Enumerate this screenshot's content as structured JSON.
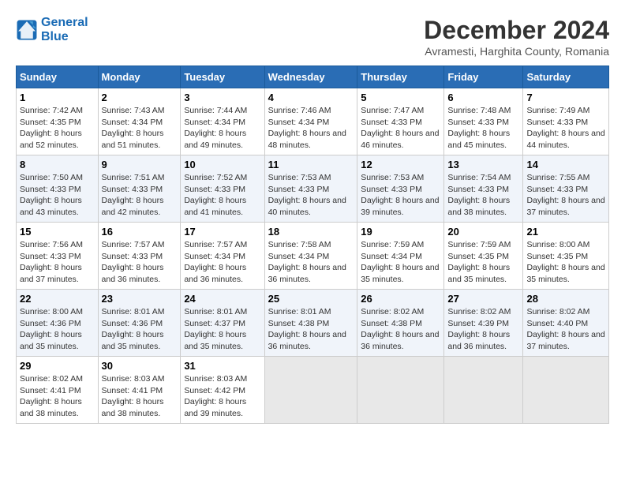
{
  "header": {
    "logo_line1": "General",
    "logo_line2": "Blue",
    "month_title": "December 2024",
    "location": "Avramesti, Harghita County, Romania"
  },
  "weekdays": [
    "Sunday",
    "Monday",
    "Tuesday",
    "Wednesday",
    "Thursday",
    "Friday",
    "Saturday"
  ],
  "weeks": [
    [
      {
        "day": "1",
        "sunrise": "7:42 AM",
        "sunset": "4:35 PM",
        "daylight": "8 hours and 52 minutes."
      },
      {
        "day": "2",
        "sunrise": "7:43 AM",
        "sunset": "4:34 PM",
        "daylight": "8 hours and 51 minutes."
      },
      {
        "day": "3",
        "sunrise": "7:44 AM",
        "sunset": "4:34 PM",
        "daylight": "8 hours and 49 minutes."
      },
      {
        "day": "4",
        "sunrise": "7:46 AM",
        "sunset": "4:34 PM",
        "daylight": "8 hours and 48 minutes."
      },
      {
        "day": "5",
        "sunrise": "7:47 AM",
        "sunset": "4:33 PM",
        "daylight": "8 hours and 46 minutes."
      },
      {
        "day": "6",
        "sunrise": "7:48 AM",
        "sunset": "4:33 PM",
        "daylight": "8 hours and 45 minutes."
      },
      {
        "day": "7",
        "sunrise": "7:49 AM",
        "sunset": "4:33 PM",
        "daylight": "8 hours and 44 minutes."
      }
    ],
    [
      {
        "day": "8",
        "sunrise": "7:50 AM",
        "sunset": "4:33 PM",
        "daylight": "8 hours and 43 minutes."
      },
      {
        "day": "9",
        "sunrise": "7:51 AM",
        "sunset": "4:33 PM",
        "daylight": "8 hours and 42 minutes."
      },
      {
        "day": "10",
        "sunrise": "7:52 AM",
        "sunset": "4:33 PM",
        "daylight": "8 hours and 41 minutes."
      },
      {
        "day": "11",
        "sunrise": "7:53 AM",
        "sunset": "4:33 PM",
        "daylight": "8 hours and 40 minutes."
      },
      {
        "day": "12",
        "sunrise": "7:53 AM",
        "sunset": "4:33 PM",
        "daylight": "8 hours and 39 minutes."
      },
      {
        "day": "13",
        "sunrise": "7:54 AM",
        "sunset": "4:33 PM",
        "daylight": "8 hours and 38 minutes."
      },
      {
        "day": "14",
        "sunrise": "7:55 AM",
        "sunset": "4:33 PM",
        "daylight": "8 hours and 37 minutes."
      }
    ],
    [
      {
        "day": "15",
        "sunrise": "7:56 AM",
        "sunset": "4:33 PM",
        "daylight": "8 hours and 37 minutes."
      },
      {
        "day": "16",
        "sunrise": "7:57 AM",
        "sunset": "4:33 PM",
        "daylight": "8 hours and 36 minutes."
      },
      {
        "day": "17",
        "sunrise": "7:57 AM",
        "sunset": "4:34 PM",
        "daylight": "8 hours and 36 minutes."
      },
      {
        "day": "18",
        "sunrise": "7:58 AM",
        "sunset": "4:34 PM",
        "daylight": "8 hours and 36 minutes."
      },
      {
        "day": "19",
        "sunrise": "7:59 AM",
        "sunset": "4:34 PM",
        "daylight": "8 hours and 35 minutes."
      },
      {
        "day": "20",
        "sunrise": "7:59 AM",
        "sunset": "4:35 PM",
        "daylight": "8 hours and 35 minutes."
      },
      {
        "day": "21",
        "sunrise": "8:00 AM",
        "sunset": "4:35 PM",
        "daylight": "8 hours and 35 minutes."
      }
    ],
    [
      {
        "day": "22",
        "sunrise": "8:00 AM",
        "sunset": "4:36 PM",
        "daylight": "8 hours and 35 minutes."
      },
      {
        "day": "23",
        "sunrise": "8:01 AM",
        "sunset": "4:36 PM",
        "daylight": "8 hours and 35 minutes."
      },
      {
        "day": "24",
        "sunrise": "8:01 AM",
        "sunset": "4:37 PM",
        "daylight": "8 hours and 35 minutes."
      },
      {
        "day": "25",
        "sunrise": "8:01 AM",
        "sunset": "4:38 PM",
        "daylight": "8 hours and 36 minutes."
      },
      {
        "day": "26",
        "sunrise": "8:02 AM",
        "sunset": "4:38 PM",
        "daylight": "8 hours and 36 minutes."
      },
      {
        "day": "27",
        "sunrise": "8:02 AM",
        "sunset": "4:39 PM",
        "daylight": "8 hours and 36 minutes."
      },
      {
        "day": "28",
        "sunrise": "8:02 AM",
        "sunset": "4:40 PM",
        "daylight": "8 hours and 37 minutes."
      }
    ],
    [
      {
        "day": "29",
        "sunrise": "8:02 AM",
        "sunset": "4:41 PM",
        "daylight": "8 hours and 38 minutes."
      },
      {
        "day": "30",
        "sunrise": "8:03 AM",
        "sunset": "4:41 PM",
        "daylight": "8 hours and 38 minutes."
      },
      {
        "day": "31",
        "sunrise": "8:03 AM",
        "sunset": "4:42 PM",
        "daylight": "8 hours and 39 minutes."
      },
      null,
      null,
      null,
      null
    ]
  ],
  "labels": {
    "sunrise": "Sunrise:",
    "sunset": "Sunset:",
    "daylight": "Daylight:"
  }
}
